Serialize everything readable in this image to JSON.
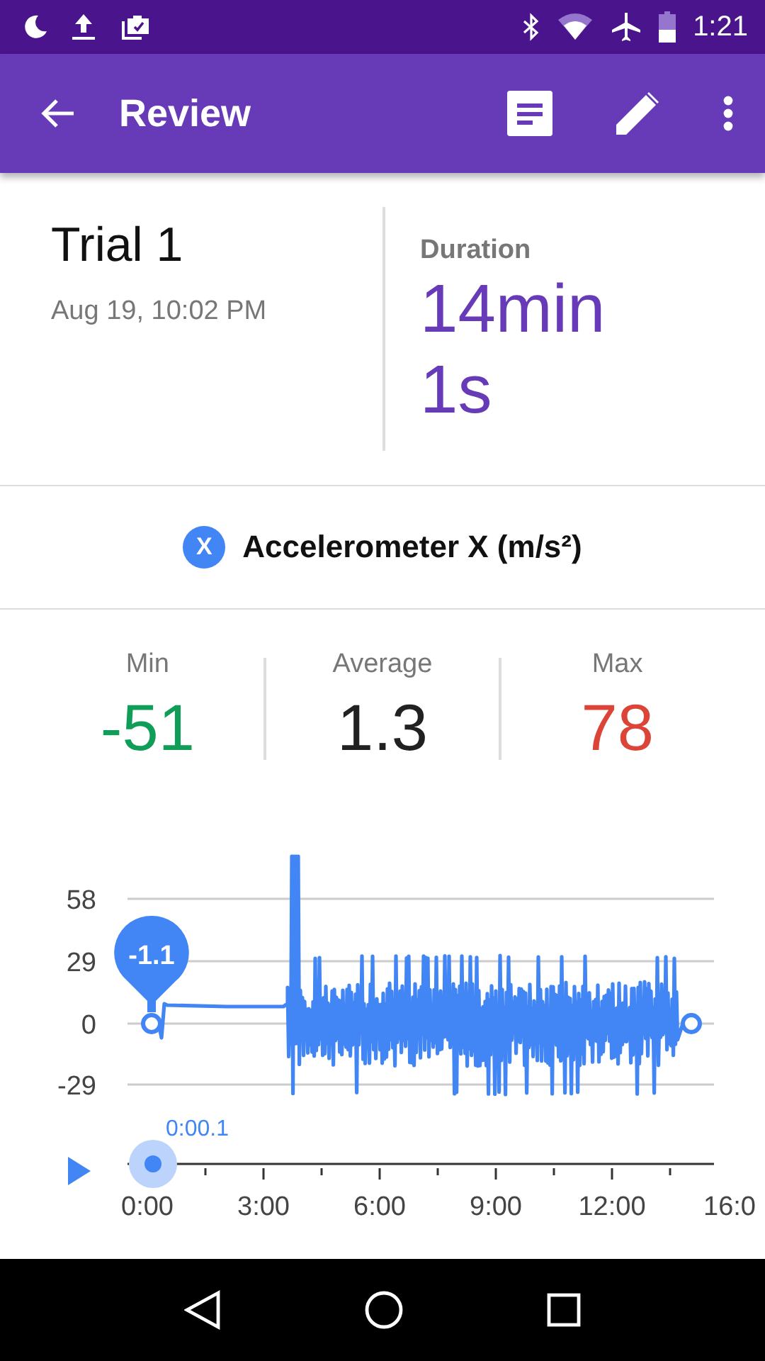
{
  "status_bar": {
    "time": "1:21"
  },
  "toolbar": {
    "title": "Review"
  },
  "trial": {
    "name": "Trial 1",
    "date": "Aug 19, 10:02 PM"
  },
  "duration": {
    "label": "Duration",
    "value": "14min 1s"
  },
  "sensor": {
    "icon_letter": "X",
    "name": "Accelerometer X (m/s²)"
  },
  "stats": [
    {
      "label": "Min",
      "value": "-51",
      "kind": "min"
    },
    {
      "label": "Average",
      "value": "1.3",
      "kind": "avg"
    },
    {
      "label": "Max",
      "value": "78",
      "kind": "max"
    }
  ],
  "chart": {
    "y_ticks": [
      "58",
      "29",
      "0",
      "-29"
    ],
    "x_ticks": [
      "0:00",
      "3:00",
      "6:00",
      "9:00",
      "12:00",
      "16:0"
    ],
    "marker_value": "-1.1",
    "playback_time": "0:00.1"
  }
}
